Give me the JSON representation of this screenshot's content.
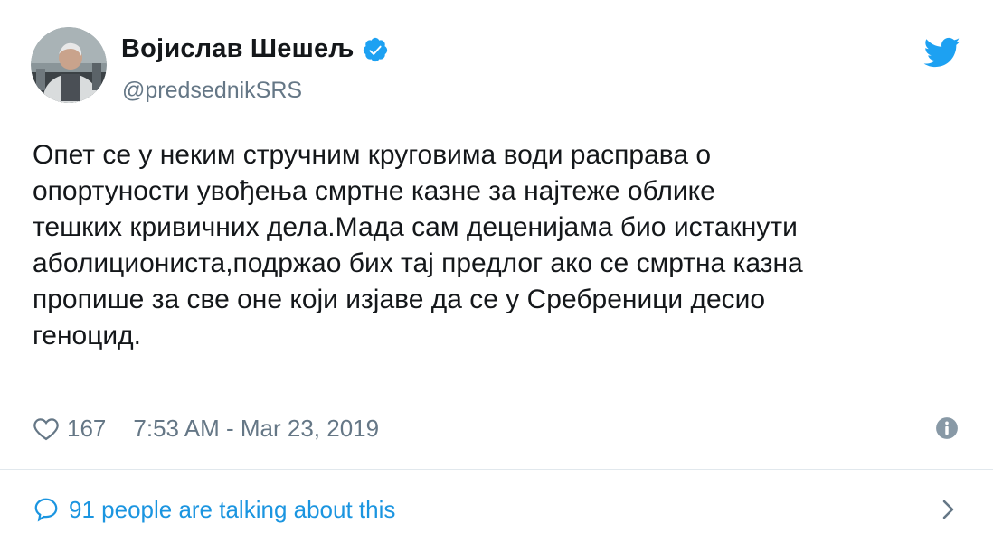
{
  "user": {
    "display_name": "Војислав Шешељ",
    "handle": "@predsednikSRS",
    "verified": true
  },
  "tweet": {
    "text": "Опет се у неким стручним круговима води расправа о\nопортуности увођења смртне казне за најтеже облике\nтешких кривичних дела.Мада сам деценијама био истакнути\nаболициониста,подржао бих тај предлог ако се смртна казна\nпропише за све оне који изјаве да се у Сребреници десио\nгеноцид."
  },
  "meta": {
    "like_count": "167",
    "timestamp": "7:53 AM - Mar 23, 2019"
  },
  "footer": {
    "talking_text": "91 people are talking about this"
  },
  "icons": {
    "brand": "twitter-bird-icon",
    "verified": "verified-badge-icon",
    "like": "heart-icon",
    "info": "info-icon",
    "conversation": "speech-bubble-icon",
    "more": "chevron-right-icon"
  },
  "colors": {
    "brand_blue": "#1da1f2",
    "link_blue": "#1b95e0",
    "text": "#14171a",
    "muted": "#657786",
    "divider": "#e1e8ed"
  }
}
